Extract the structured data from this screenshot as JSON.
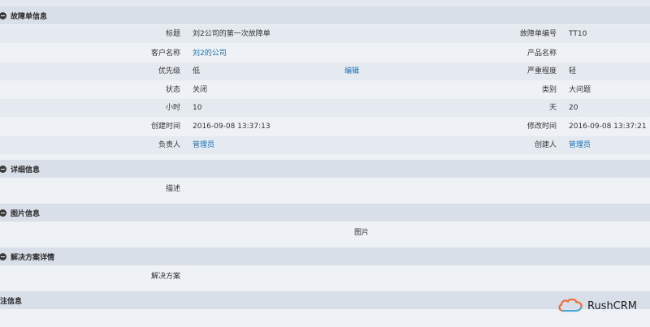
{
  "sections": {
    "fault": "故障单信息",
    "detail": "详细信息",
    "image": "图片信息",
    "solution": "解决方案详情",
    "note": "注信息"
  },
  "fields": {
    "title_label": "标题",
    "title_value": "刘2公司的第一次故障单",
    "number_label": "故障单编号",
    "number_value": "TT10",
    "customer_label": "客户名称",
    "customer_value": "刘2的公司",
    "product_label": "产品名称",
    "product_value": "",
    "priority_label": "优先级",
    "priority_value": "低",
    "edit_link": "编辑",
    "severity_label": "严重程度",
    "severity_value": "轻",
    "status_label": "状态",
    "status_value": "关闭",
    "category_label": "类别",
    "category_value": "大问题",
    "hours_label": "小时",
    "hours_value": "10",
    "days_label": "天",
    "days_value": "20",
    "created_label": "创建时间",
    "created_value": "2016-09-08 13:37:13",
    "modified_label": "修改时间",
    "modified_value": "2016-09-08 13:37:21",
    "owner_label": "负责人",
    "owner_value": "管理员",
    "creator_label": "创建人",
    "creator_value": "管理员",
    "description_label": "描述",
    "image_label": "图片",
    "solution_label": "解决方案"
  },
  "brand": {
    "name": "RushCRM",
    "logo_icon": "cloud-icon",
    "logo_colors": [
      "#f26b3a",
      "#4aa8d8"
    ]
  },
  "colors": {
    "section_bg": "#d8dfe8",
    "row_light": "#eef1f5",
    "row_dark": "#e5eaf0",
    "link": "#1a6fb8"
  }
}
